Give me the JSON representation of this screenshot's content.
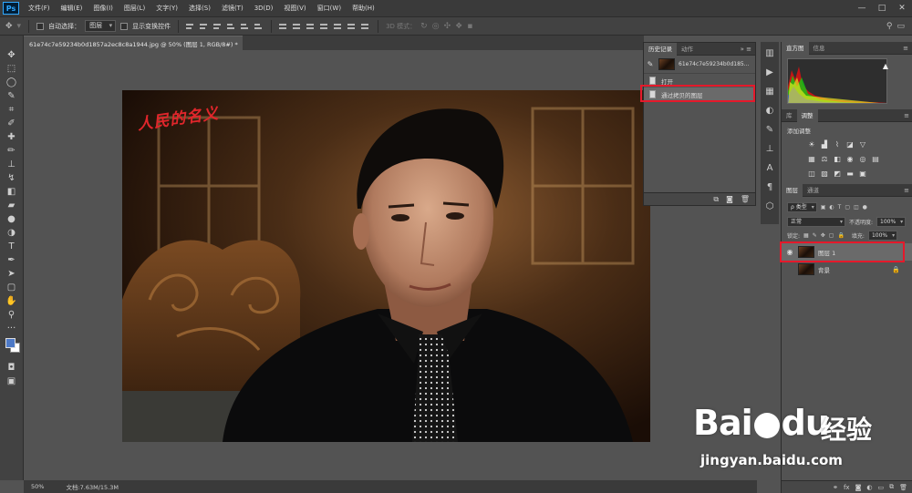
{
  "app": {
    "logo": "Ps"
  },
  "menubar": {
    "items": [
      "文件(F)",
      "编辑(E)",
      "图像(I)",
      "图层(L)",
      "文字(Y)",
      "选择(S)",
      "滤镜(T)",
      "3D(D)",
      "视图(V)",
      "窗口(W)",
      "帮助(H)"
    ],
    "window_controls": [
      "—",
      "□",
      "✕"
    ]
  },
  "options_bar": {
    "auto_select_label": "自动选择：",
    "auto_select_value": "图层",
    "show_transform_label": "显示变换控件",
    "mode_3d_label": "3D 模式："
  },
  "document": {
    "tab_title": "61e74c7e59234b0d1857a2ec8c8a1944.jpg @ 50% (图层 1, RGB/8#) *",
    "close_glyph": "×",
    "photo_caption": "人民的名义"
  },
  "status_bar": {
    "zoom": "50%",
    "doc_size": "文档:7.63M/15.3M"
  },
  "history_panel": {
    "tabs": [
      "历史记录",
      "动作"
    ],
    "snapshot_name": "61e74c7e59234b0d185...",
    "steps": [
      {
        "label": "打开",
        "selected": false
      },
      {
        "label": "通过拷贝的图层",
        "selected": true
      }
    ]
  },
  "histogram_panel": {
    "tabs": [
      "直方图",
      "信息"
    ]
  },
  "adjustments_panel": {
    "tabs": [
      "库",
      "调整"
    ],
    "title": "添加调整"
  },
  "layers_panel": {
    "tabs": [
      "图层",
      "通道"
    ],
    "filter_value": "ρ 类型",
    "blend_mode": "正常",
    "opacity_label": "不透明度:",
    "opacity_value": "100%",
    "lock_label": "锁定:",
    "fill_label": "填充:",
    "fill_value": "100%",
    "layers": [
      {
        "name": "图层 1",
        "selected": true,
        "visible": true,
        "locked": false
      },
      {
        "name": "背景",
        "selected": false,
        "visible": false,
        "locked": true
      }
    ]
  },
  "watermark": {
    "brand": "Bai",
    "brand2": "du",
    "cn": "经验",
    "url": "jingyan.baidu.com"
  },
  "colors": {
    "highlight_box": "#e5192b",
    "foreground_swatch": "#4d79c6",
    "background_swatch": "#ffffff"
  }
}
